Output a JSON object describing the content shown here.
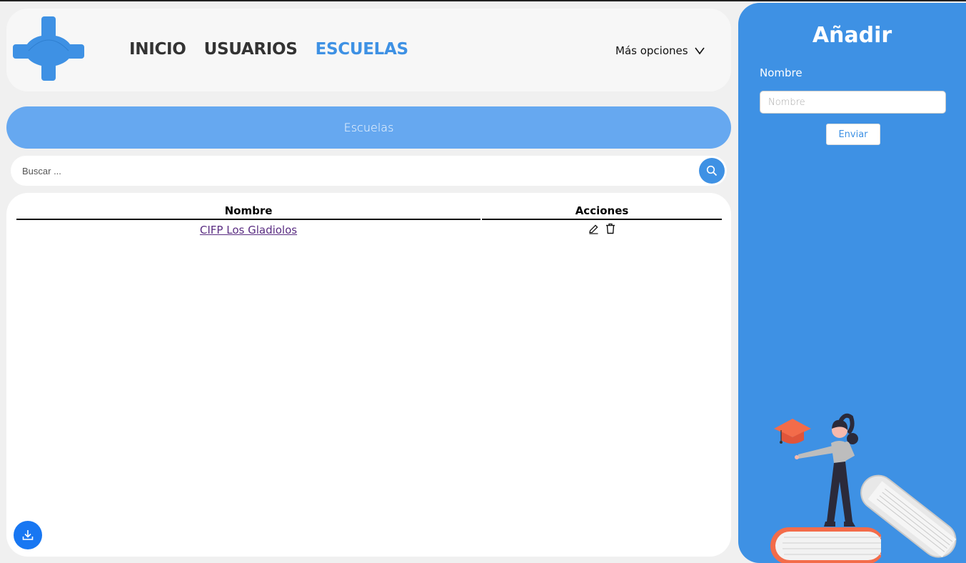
{
  "nav": {
    "items": [
      "INICIO",
      "USUARIOS",
      "ESCUELAS"
    ],
    "active": "ESCUELAS",
    "more_label": "Más opciones"
  },
  "banner": {
    "title": "Escuelas"
  },
  "search": {
    "placeholder": "Buscar ..."
  },
  "table": {
    "headers": [
      "Nombre",
      "Acciones"
    ],
    "rows": [
      {
        "name": "CIFP Los Gladiolos"
      }
    ]
  },
  "form": {
    "title": "Añadir",
    "field_label": "Nombre",
    "field_placeholder": "Nombre",
    "submit_label": "Enviar"
  },
  "colors": {
    "accent": "#3e91e4",
    "banner": "#66a8f0",
    "link": "#5a2d82",
    "download_button": "#1877f2",
    "illustration_accent": "#f36c4a"
  },
  "icons": [
    "logo-cross-icon",
    "chevron-down-icon",
    "search-icon",
    "edit-pencil-icon",
    "trash-icon",
    "download-icon"
  ]
}
